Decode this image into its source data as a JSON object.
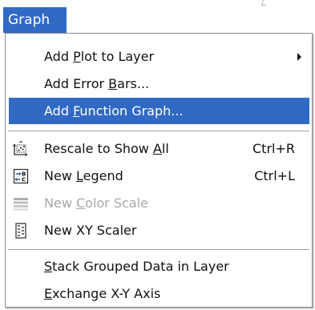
{
  "menubar": {
    "graph_label": "Graph"
  },
  "menu": {
    "add_plot_to_layer": {
      "text": "Add Plot to Layer",
      "pre": "Add ",
      "mnemonic": "P",
      "post": "lot to Layer",
      "has_submenu": true
    },
    "add_error_bars": {
      "text": "Add Error Bars...",
      "pre": "Add Error ",
      "mnemonic": "B",
      "post": "ars..."
    },
    "add_function_graph": {
      "text": "Add Function Graph...",
      "pre": "Add ",
      "mnemonic": "F",
      "post": "unction Graph...",
      "state": "highlighted"
    },
    "rescale_to_show_all": {
      "text": "Rescale to Show All",
      "pre": "Rescale to Show ",
      "mnemonic": "A",
      "post": "ll",
      "shortcut": "Ctrl+R",
      "icon": "rescale-icon"
    },
    "new_legend": {
      "text": "New Legend",
      "pre": "New ",
      "mnemonic": "L",
      "post": "egend",
      "shortcut": "Ctrl+L",
      "icon": "legend-icon"
    },
    "new_color_scale": {
      "text": "New Color Scale",
      "pre": "New ",
      "mnemonic": "C",
      "post": "olor Scale",
      "state": "disabled",
      "icon": "color-scale-icon"
    },
    "new_xy_scaler": {
      "text": "New XY Scaler",
      "pre": "New XY Scaler",
      "mnemonic": "",
      "post": "",
      "icon": "xy-scaler-icon"
    },
    "stack_grouped_data": {
      "text": "Stack Grouped Data in Layer",
      "pre": "",
      "mnemonic": "S",
      "post": "tack Grouped Data in Layer"
    },
    "exchange_xy_axis": {
      "text": "Exchange X-Y Axis",
      "pre": "",
      "mnemonic": "E",
      "post": "xchange X-Y Axis"
    }
  },
  "colors": {
    "highlight": "#316ac5",
    "highlight_text": "#ffffff",
    "disabled_text": "#a7a7a7"
  }
}
